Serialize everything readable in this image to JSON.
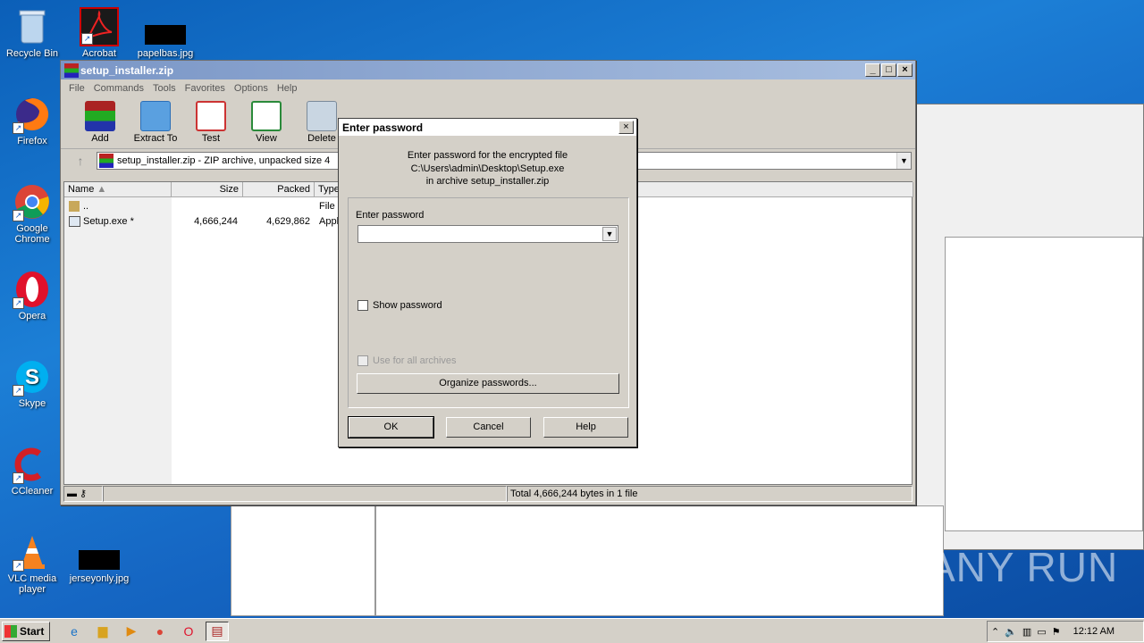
{
  "desktop": {
    "icons": [
      {
        "label": "Recycle Bin"
      },
      {
        "label": "Acrobat"
      },
      {
        "label": "papelbas.jpg"
      },
      {
        "label": "Firefox"
      },
      {
        "label": "Google Chrome"
      },
      {
        "label": "Opera"
      },
      {
        "label": "Skype"
      },
      {
        "label": "CCleaner"
      },
      {
        "label": "VLC media player"
      },
      {
        "label": "jerseyonly.jpg"
      }
    ],
    "watermark": "ANY RUN"
  },
  "window": {
    "title": "setup_installer.zip",
    "menu": [
      "File",
      "Commands",
      "Tools",
      "Favorites",
      "Options",
      "Help"
    ],
    "toolbar": [
      {
        "label": "Add",
        "icon": "winrar-add-icon"
      },
      {
        "label": "Extract To",
        "icon": "folder-extract-icon"
      },
      {
        "label": "Test",
        "icon": "test-checklist-icon"
      },
      {
        "label": "View",
        "icon": "book-view-icon"
      },
      {
        "label": "Delete",
        "icon": "trash-icon"
      }
    ],
    "address": "setup_installer.zip - ZIP archive, unpacked size 4",
    "columns": {
      "name": "Name",
      "size": "Size",
      "packed": "Packed",
      "type": "Type"
    },
    "rows": [
      {
        "name": "..",
        "size": "",
        "packed": "",
        "type": "File"
      },
      {
        "name": "Setup.exe *",
        "size": "4,666,244",
        "packed": "4,629,862",
        "type": "Appl"
      }
    ],
    "status": "Total 4,666,244 bytes in 1 file"
  },
  "dialog": {
    "title": "Enter password",
    "message_line1": "Enter password for the encrypted file",
    "message_line2": "C:\\Users\\admin\\Desktop\\Setup.exe",
    "message_line3": "in archive setup_installer.zip",
    "password_label": "Enter password",
    "password_value": "",
    "show_password": "Show password",
    "use_for_all": "Use for all archives",
    "organize": "Organize passwords...",
    "ok": "OK",
    "cancel": "Cancel",
    "help": "Help"
  },
  "taskbar": {
    "start": "Start",
    "clock": "12:12 AM"
  }
}
